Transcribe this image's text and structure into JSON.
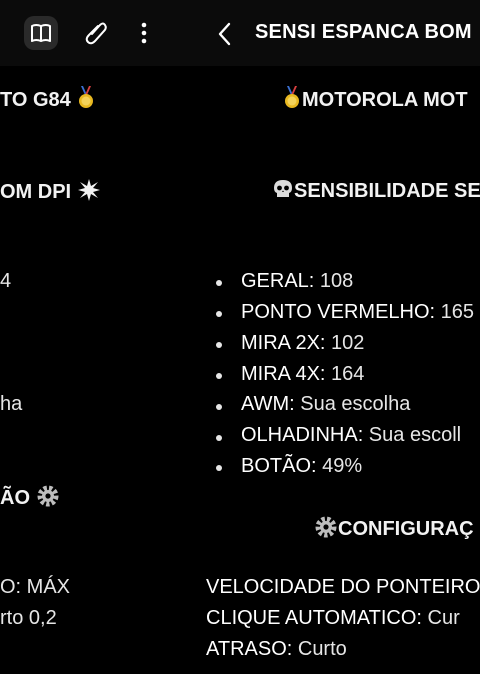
{
  "topbar": {
    "title": "SENSI ESPANCA BOM",
    "icons": [
      "book-icon",
      "paperclip-icon",
      "more-vert-icon",
      "back-arrow-icon"
    ]
  },
  "left_column": {
    "heading_1": "TO G84",
    "heading_2": "OM DPI",
    "value_1": "4",
    "value_2": "ha",
    "heading_3": "ÃO",
    "config_1": "O:  MÁX",
    "config_2": "rto 0,2"
  },
  "right_column": {
    "heading_1": "MOTOROLA MOT",
    "heading_2": "SENSIBILIDADE SE",
    "items": [
      {
        "label": "GERAL:",
        "value": " 108"
      },
      {
        "label": "PONTO VERMELHO:",
        "value": " 165"
      },
      {
        "label": "MIRA 2X:",
        "value": " 102"
      },
      {
        "label": "MIRA 4X:",
        "value": " 164"
      },
      {
        "label": "AWM:",
        "value": " Sua escolha"
      },
      {
        "label": "OLHADINHA:",
        "value": " Sua escoll"
      },
      {
        "label": "BOTÃO:",
        "value": " 49%"
      }
    ],
    "heading_3": "CONFIGURAÇ",
    "config": [
      {
        "label": "VELOCIDADE DO PONTEIRO",
        "value": ""
      },
      {
        "label": "CLIQUE AUTOMATICO:",
        "value": "  Cur"
      },
      {
        "label": "ATRASO:",
        "value": "  Curto"
      }
    ]
  }
}
